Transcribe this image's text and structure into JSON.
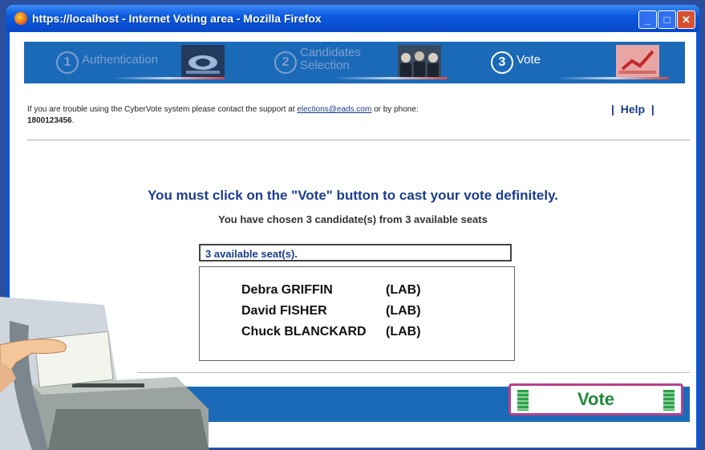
{
  "window": {
    "title": "https://localhost - Internet Voting area - Mozilla Firefox"
  },
  "steps": [
    {
      "number": "1",
      "label": "Authentication"
    },
    {
      "number": "2",
      "label_line1": "Candidates",
      "label_line2": "Selection"
    },
    {
      "number": "3",
      "label": "Vote"
    }
  ],
  "support": {
    "text_before": "If you are trouble using the CyberVote system please contact the support at",
    "email": "elections@eads.com",
    "text_after": "or by phone:",
    "phone": "1800123456",
    "phone_suffix": "."
  },
  "help": {
    "sep_left": "|",
    "label": "Help",
    "sep_right": "|"
  },
  "main": {
    "headline": "You must click on the \"Vote\" button to cast your vote definitely.",
    "subline": "You have chosen 3 candidate(s) from 3 available seats",
    "seats_label": "3 available seat(s).",
    "candidates": [
      {
        "name": "Debra GRIFFIN",
        "party": "(LAB)"
      },
      {
        "name": "David FISHER",
        "party": "(LAB)"
      },
      {
        "name": "Chuck BLANCKARD",
        "party": "(LAB)"
      }
    ]
  },
  "vote_button": {
    "label": "Vote"
  },
  "colors": {
    "brand_blue": "#1a6ab8",
    "headline_blue": "#1a3d8f",
    "vote_green": "#1f8a3a",
    "vote_border": "#b6408a"
  }
}
